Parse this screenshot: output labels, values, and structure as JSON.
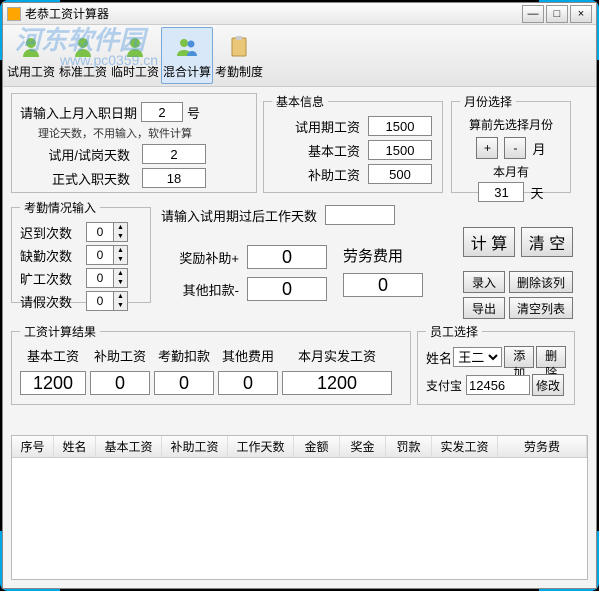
{
  "titlebar": {
    "title": "老恭工资计算器"
  },
  "watermark": {
    "text": "河东软件园",
    "url": "www.pc0359.cn"
  },
  "toolbar": {
    "items": [
      {
        "label": "试用工资"
      },
      {
        "label": "标准工资"
      },
      {
        "label": "临时工资"
      },
      {
        "label": "混合计算"
      },
      {
        "label": "考勤制度"
      }
    ]
  },
  "top_form": {
    "entry_prompt": "请输入上月入职日期",
    "entry_value": "2",
    "entry_suffix": "号",
    "note": "理论天数，不用输入，软件计算",
    "trial_days_label": "试用/试岗天数",
    "trial_days_value": "2",
    "formal_days_label": "正式入职天数",
    "formal_days_value": "18"
  },
  "basic_info": {
    "legend": "基本信息",
    "trial_salary_label": "试用期工资",
    "trial_salary_value": "1500",
    "base_salary_label": "基本工资",
    "base_salary_value": "1500",
    "allowance_label": "补助工资",
    "allowance_value": "500"
  },
  "month_select": {
    "legend": "月份选择",
    "pre_label": "算前先选择月份",
    "month_suffix": "月",
    "days_label": "本月有",
    "days_value": "31",
    "days_suffix": "天"
  },
  "attendance": {
    "legend": "考勤情况输入",
    "late_label": "迟到次数",
    "late_value": "0",
    "absent_label": "缺勤次数",
    "absent_value": "0",
    "skip_label": "旷工次数",
    "skip_value": "0",
    "leave_label": "请假次数",
    "leave_value": "0"
  },
  "workdays_after": {
    "label": "请输入试用期过后工作天数",
    "value": ""
  },
  "bonus": {
    "label": "奖励补助+",
    "value": "0"
  },
  "other_deduct": {
    "label": "其他扣款-",
    "value": "0"
  },
  "labor_fee": {
    "label": "劳务费用",
    "value": "0"
  },
  "actions": {
    "calc": "计 算",
    "clear": "清 空",
    "record": "录入",
    "del_row": "删除该列",
    "export": "导出",
    "clear_list": "清空列表"
  },
  "result": {
    "legend": "工资计算结果",
    "headers": {
      "base": "基本工资",
      "allow": "补助工资",
      "attend_deduct": "考勤扣款",
      "other": "其他费用",
      "actual": "本月实发工资"
    },
    "values": {
      "base": "1200",
      "allow": "0",
      "attend_deduct": "0",
      "other": "0",
      "actual": "1200"
    }
  },
  "employee": {
    "legend": "员工选择",
    "name_label": "姓名",
    "name_value": "王二",
    "add": "添加",
    "del": "删除",
    "alipay_label": "支付宝",
    "alipay_value": "12456",
    "edit": "修改"
  },
  "table": {
    "columns": [
      "序号",
      "姓名",
      "基本工资",
      "补助工资",
      "工作天数",
      "金额",
      "奖金",
      "罚款",
      "实发工资",
      "劳务费"
    ]
  }
}
